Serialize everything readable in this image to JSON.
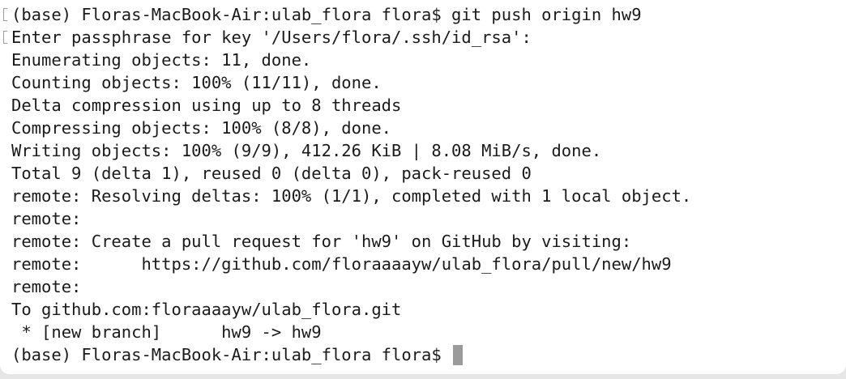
{
  "terminal": {
    "lines": [
      {
        "text": "(base) Floras-MacBook-Air:ulab_flora flora$ git push origin hw9",
        "marked": true
      },
      {
        "text": "Enter passphrase for key '/Users/flora/.ssh/id_rsa':",
        "marked": true
      },
      {
        "text": "Enumerating objects: 11, done."
      },
      {
        "text": "Counting objects: 100% (11/11), done."
      },
      {
        "text": "Delta compression using up to 8 threads"
      },
      {
        "text": "Compressing objects: 100% (8/8), done."
      },
      {
        "text": "Writing objects: 100% (9/9), 412.26 KiB | 8.08 MiB/s, done."
      },
      {
        "text": "Total 9 (delta 1), reused 0 (delta 0), pack-reused 0"
      },
      {
        "text": "remote: Resolving deltas: 100% (1/1), completed with 1 local object."
      },
      {
        "text": "remote:"
      },
      {
        "text": "remote: Create a pull request for 'hw9' on GitHub by visiting:"
      },
      {
        "text": "remote:      https://github.com/floraaaayw/ulab_flora/pull/new/hw9"
      },
      {
        "text": "remote:"
      },
      {
        "text": "To github.com:floraaaayw/ulab_flora.git"
      },
      {
        "text": " * [new branch]      hw9 -> hw9"
      }
    ],
    "prompt": "(base) Floras-MacBook-Air:ulab_flora flora$ ",
    "colors": {
      "background": "#ffffff",
      "text": "#1a1a1a",
      "cursor": "#9b9b9b",
      "window_frame": "#e6e6e6"
    }
  }
}
